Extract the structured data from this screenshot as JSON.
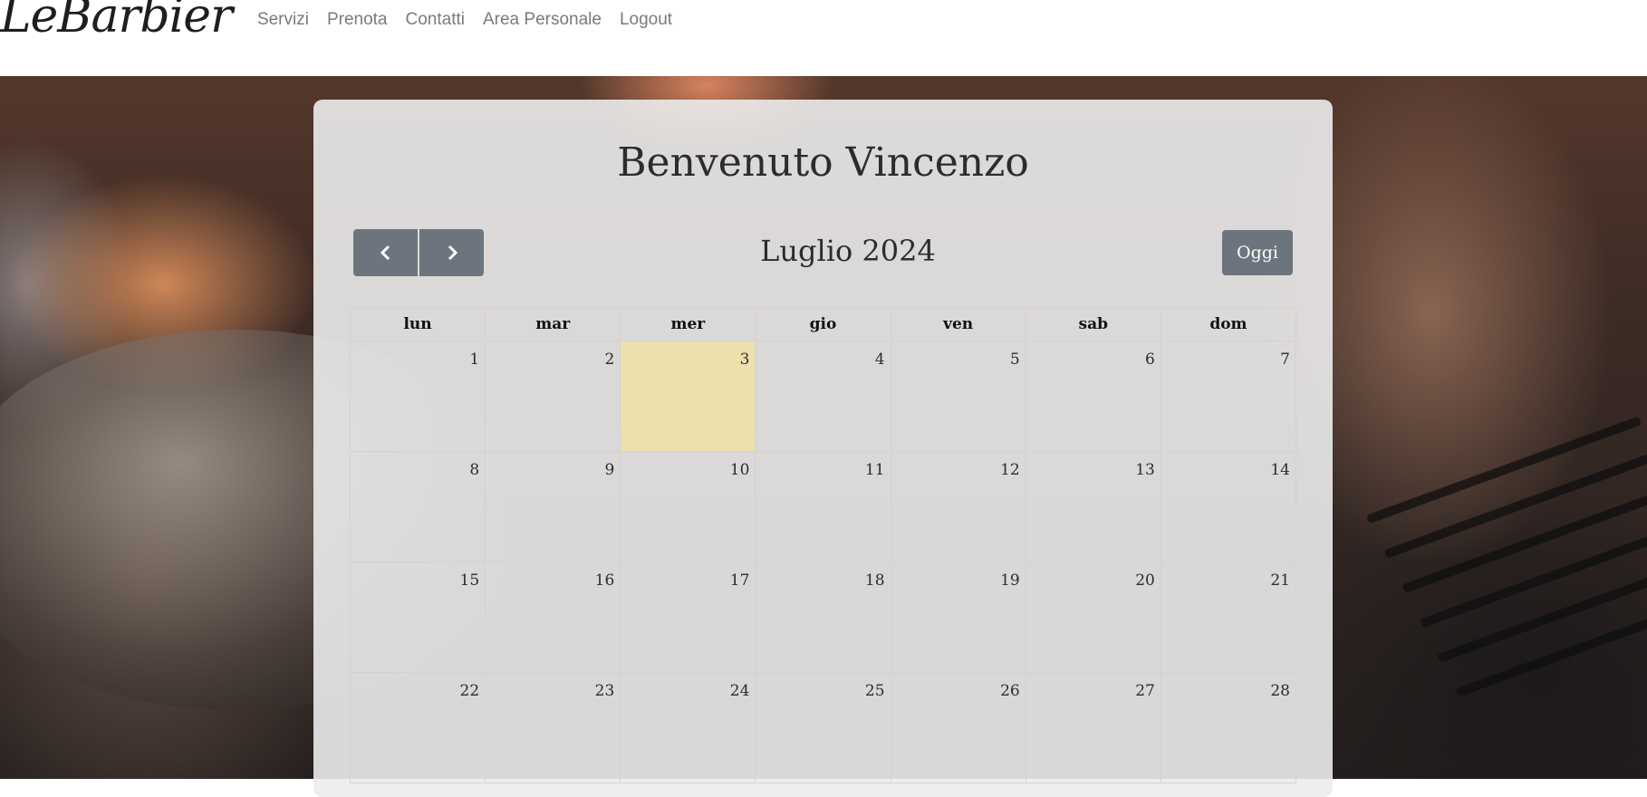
{
  "navbar": {
    "brand": "LeBarbier",
    "links": [
      "Servizi",
      "Prenota",
      "Contatti",
      "Area Personale",
      "Logout"
    ]
  },
  "welcome": "Benvenuto Vincenzo",
  "calendar": {
    "title": "Luglio 2024",
    "today_label": "Oggi",
    "weekdays": [
      "lun",
      "mar",
      "mer",
      "gio",
      "ven",
      "sab",
      "dom"
    ],
    "weeks": [
      [
        "1",
        "2",
        "3",
        "4",
        "5",
        "6",
        "7"
      ],
      [
        "8",
        "9",
        "10",
        "11",
        "12",
        "13",
        "14"
      ],
      [
        "15",
        "16",
        "17",
        "18",
        "19",
        "20",
        "21"
      ],
      [
        "22",
        "23",
        "24",
        "25",
        "26",
        "27",
        "28"
      ]
    ],
    "highlighted_day": "3"
  },
  "colors": {
    "button": "#6c757d",
    "today_highlight": "#f0e1a5",
    "nav_link": "#7a7a7a"
  }
}
